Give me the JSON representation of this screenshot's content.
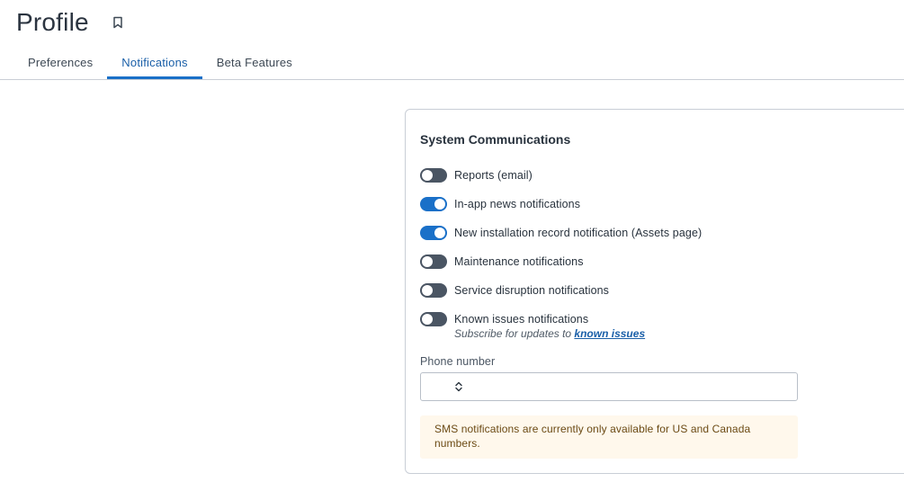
{
  "header": {
    "title": "Profile",
    "bookmark_icon": "bookmark-icon"
  },
  "tabs": [
    {
      "label": "Preferences",
      "active": false
    },
    {
      "label": "Notifications",
      "active": true
    },
    {
      "label": "Beta Features",
      "active": false
    }
  ],
  "colors": {
    "accent": "#1a70c8",
    "toggle_off": "#4a5563",
    "notice_bg": "#fff8ec"
  },
  "system_communications": {
    "title": "System Communications",
    "items": [
      {
        "label": "Reports (email)",
        "enabled": false
      },
      {
        "label": "In-app news notifications",
        "enabled": true
      },
      {
        "label": "New installation record notification (Assets page)",
        "enabled": true
      },
      {
        "label": "Maintenance notifications",
        "enabled": false
      },
      {
        "label": "Service disruption notifications",
        "enabled": false
      },
      {
        "label": "Known issues notifications",
        "enabled": false,
        "sub_prefix": "Subscribe for updates to ",
        "sub_link": "known issues"
      }
    ],
    "phone": {
      "label": "Phone number",
      "value": "",
      "country_select_icon": "chevron-up-down-icon"
    },
    "notice": "SMS notifications are currently only available for US and Canada numbers."
  }
}
